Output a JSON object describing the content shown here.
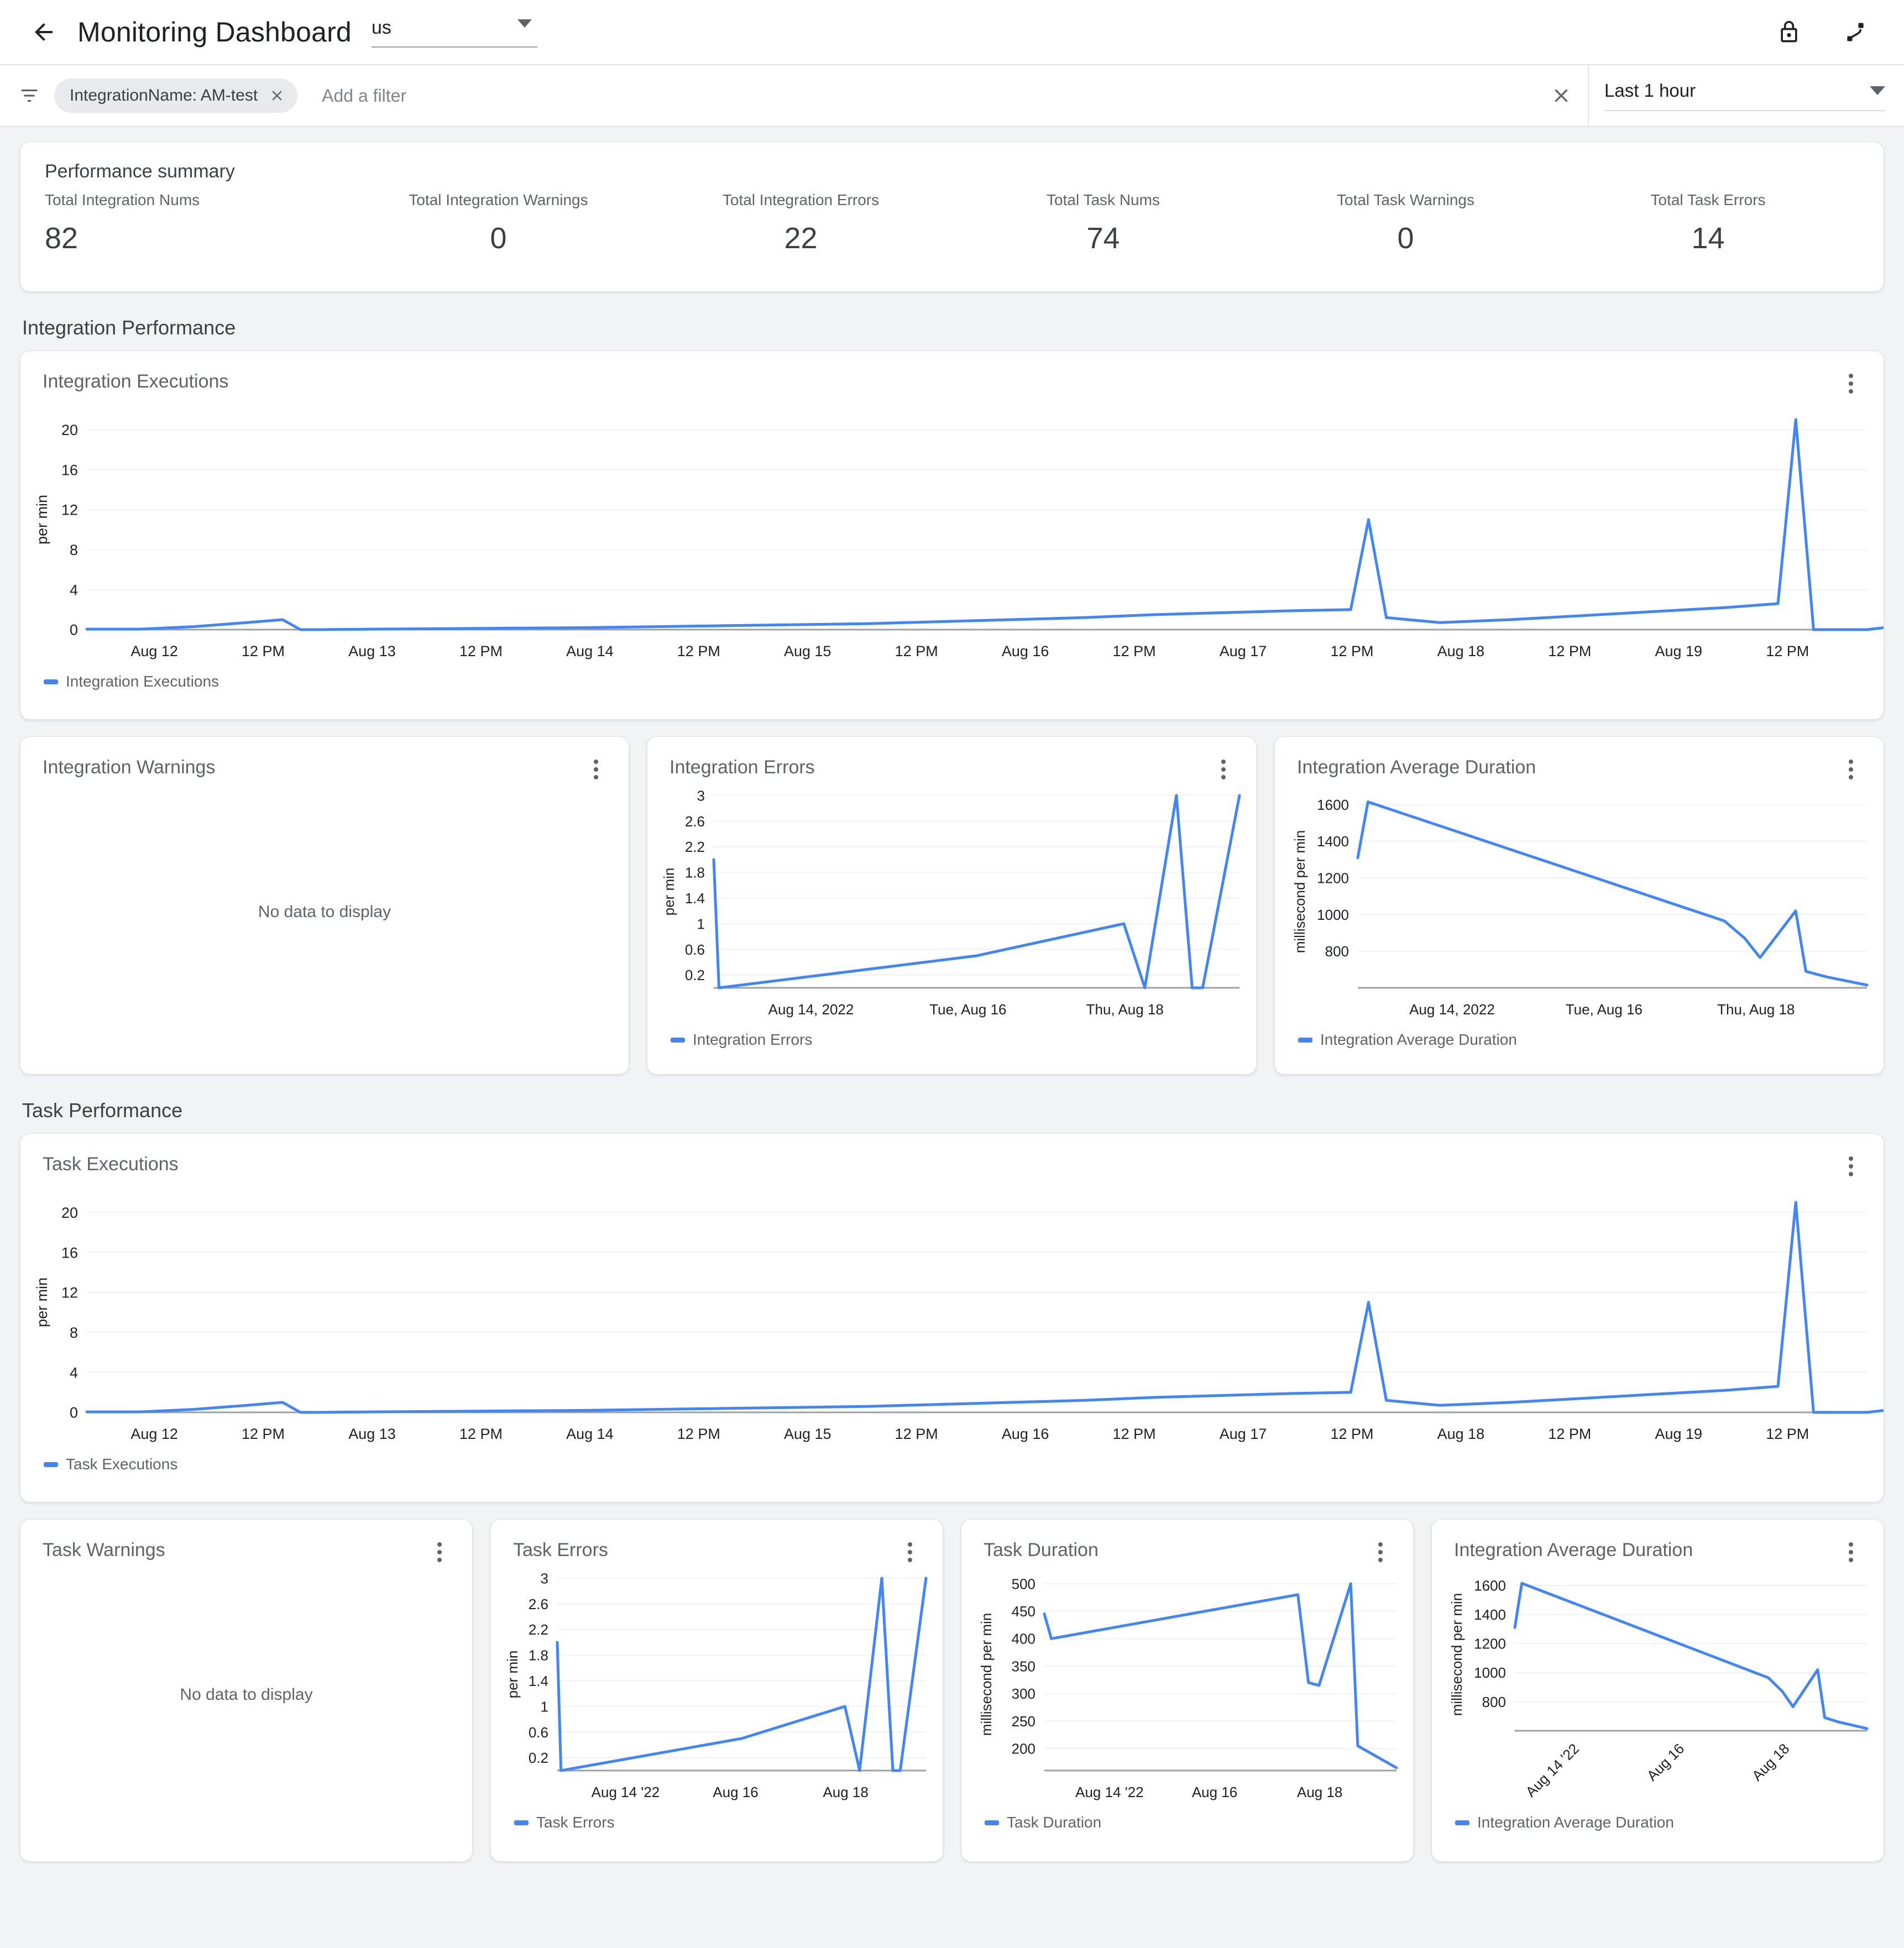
{
  "appbar": {
    "title": "Monitoring Dashboard",
    "back_icon": "back-arrow-icon",
    "region_value": "us",
    "lock_icon": "lock-icon",
    "connection_icon": "connection-cable-icon"
  },
  "filterbar": {
    "filter_icon": "filter-list-icon",
    "chip_label": "IntegrationName: AM-test",
    "chip_remove_icon": "close-icon",
    "add_filter_placeholder": "Add a filter",
    "clear_icon": "close-icon",
    "time_range_value": "Last 1 hour"
  },
  "summary": {
    "title": "Performance summary",
    "metrics": [
      {
        "label": "Total Integration Nums",
        "value": "82"
      },
      {
        "label": "Total Integration Warnings",
        "value": "0"
      },
      {
        "label": "Total Integration Errors",
        "value": "22"
      },
      {
        "label": "Total Task Nums",
        "value": "74"
      },
      {
        "label": "Total Task Warnings",
        "value": "0"
      },
      {
        "label": "Total Task Errors",
        "value": "14"
      }
    ]
  },
  "sections": {
    "integration_performance": "Integration Performance",
    "task_performance": "Task Performance"
  },
  "cards": {
    "integration_executions": {
      "title": "Integration Executions",
      "legend": "Integration Executions"
    },
    "integration_warnings": {
      "title": "Integration Warnings",
      "empty": "No data to display"
    },
    "integration_errors": {
      "title": "Integration Errors",
      "legend": "Integration Errors"
    },
    "integration_avg_duration": {
      "title": "Integration Average Duration",
      "legend": "Integration Average Duration"
    },
    "task_executions": {
      "title": "Task Executions",
      "legend": "Task Executions"
    },
    "task_warnings": {
      "title": "Task Warnings",
      "empty": "No data to display"
    },
    "task_errors": {
      "title": "Task Errors",
      "legend": "Task Errors"
    },
    "task_duration": {
      "title": "Task Duration",
      "legend": "Task Duration"
    },
    "task_integration_avg_duration": {
      "title": "Integration Average Duration",
      "legend": "Integration Average Duration"
    }
  },
  "colors": {
    "series_blue": "#4285f4",
    "axis_gray": "#80868b",
    "grid_gray": "#f1f1f1",
    "page_bg": "#f1f3f4"
  },
  "chart_data": [
    {
      "id": "integration_executions",
      "type": "line",
      "title": "Integration Executions",
      "ylabel": "per min",
      "xlabel": "",
      "ylim": [
        0,
        22
      ],
      "yticks": [
        0,
        4,
        8,
        12,
        16,
        20
      ],
      "grid": true,
      "legend": [
        "Integration Executions"
      ],
      "legend_position": "bottom-left",
      "xticks": [
        "Aug 12",
        "12 PM",
        "Aug 13",
        "12 PM",
        "Aug 14",
        "12 PM",
        "Aug 15",
        "12 PM",
        "Aug 16",
        "12 PM",
        "Aug 17",
        "12 PM",
        "Aug 18",
        "12 PM",
        "Aug 19",
        "12 PM"
      ],
      "series": [
        {
          "name": "Integration Executions",
          "x": [
            0,
            3,
            6,
            9,
            11,
            12,
            13,
            16,
            20,
            24,
            28,
            32,
            36,
            40,
            44,
            48,
            52,
            56,
            60,
            64,
            68,
            71,
            72,
            73,
            76,
            80,
            84,
            88,
            92,
            95,
            96,
            97,
            100,
            104,
            108,
            112
          ],
          "values": [
            0.05,
            0.05,
            0.3,
            0.7,
            1.0,
            0.0,
            0.0,
            0.05,
            0.1,
            0.15,
            0.2,
            0.3,
            0.4,
            0.5,
            0.6,
            0.8,
            1.0,
            1.2,
            1.5,
            1.7,
            1.9,
            2.0,
            11.0,
            1.2,
            0.7,
            1.0,
            1.4,
            1.8,
            2.2,
            2.6,
            21.0,
            0.0,
            0.0,
            0.8,
            1.8,
            2.7
          ]
        }
      ]
    },
    {
      "id": "integration_warnings",
      "type": "line",
      "title": "Integration Warnings",
      "empty": true,
      "empty_text": "No data to display",
      "series": []
    },
    {
      "id": "integration_errors",
      "type": "line",
      "title": "Integration Errors",
      "ylabel": "per min",
      "xlabel": "",
      "ylim": [
        0,
        3
      ],
      "yticks": [
        0.2,
        0.6,
        1,
        1.4,
        1.8,
        2.2,
        2.6,
        3
      ],
      "grid": true,
      "legend": [
        "Integration Errors"
      ],
      "legend_position": "bottom-left",
      "xticks": [
        "Aug 14, 2022",
        "Tue, Aug 16",
        "Thu, Aug 18"
      ],
      "series": [
        {
          "name": "Integration Errors",
          "x": [
            0,
            1,
            50,
            78,
            82,
            88,
            91,
            93,
            100
          ],
          "values": [
            2.0,
            0.0,
            0.5,
            1.0,
            0.0,
            3.0,
            0.0,
            0.0,
            3.0
          ]
        }
      ]
    },
    {
      "id": "integration_avg_duration",
      "type": "line",
      "title": "Integration Average Duration",
      "ylabel": "millisecond per min",
      "xlabel": "",
      "ylim": [
        600,
        1650
      ],
      "yticks": [
        800,
        1000,
        1200,
        1400,
        1600
      ],
      "grid": true,
      "legend": [
        "Integration Average Duration"
      ],
      "legend_position": "bottom-left",
      "xticks": [
        "Aug 14, 2022",
        "Tue, Aug 16",
        "Thu, Aug 18"
      ],
      "series": [
        {
          "name": "Integration Average Duration",
          "x": [
            0,
            2,
            72,
            76,
            79,
            86,
            88,
            92,
            100
          ],
          "values": [
            1310,
            1615,
            965,
            870,
            765,
            1020,
            690,
            660,
            615
          ]
        }
      ]
    },
    {
      "id": "task_executions",
      "type": "line",
      "title": "Task Executions",
      "ylabel": "per min",
      "xlabel": "",
      "ylim": [
        0,
        22
      ],
      "yticks": [
        0,
        4,
        8,
        12,
        16,
        20
      ],
      "grid": true,
      "legend": [
        "Task Executions"
      ],
      "legend_position": "bottom-left",
      "xticks": [
        "Aug 12",
        "12 PM",
        "Aug 13",
        "12 PM",
        "Aug 14",
        "12 PM",
        "Aug 15",
        "12 PM",
        "Aug 16",
        "12 PM",
        "Aug 17",
        "12 PM",
        "Aug 18",
        "12 PM",
        "Aug 19",
        "12 PM"
      ],
      "series": [
        {
          "name": "Task Executions",
          "x": [
            0,
            3,
            6,
            9,
            11,
            12,
            13,
            16,
            20,
            24,
            28,
            32,
            36,
            40,
            44,
            48,
            52,
            56,
            60,
            64,
            68,
            71,
            72,
            73,
            76,
            80,
            84,
            88,
            92,
            95,
            96,
            97,
            100,
            104,
            108,
            112
          ],
          "values": [
            0.05,
            0.05,
            0.3,
            0.7,
            1.0,
            0.0,
            0.0,
            0.05,
            0.1,
            0.15,
            0.2,
            0.3,
            0.4,
            0.5,
            0.6,
            0.8,
            1.0,
            1.2,
            1.5,
            1.7,
            1.9,
            2.0,
            11.0,
            1.2,
            0.7,
            1.0,
            1.4,
            1.8,
            2.2,
            2.6,
            21.0,
            0.0,
            0.0,
            0.8,
            1.8,
            2.7
          ]
        }
      ]
    },
    {
      "id": "task_warnings",
      "type": "line",
      "title": "Task Warnings",
      "empty": true,
      "empty_text": "No data to display",
      "series": []
    },
    {
      "id": "task_errors",
      "type": "line",
      "title": "Task Errors",
      "ylabel": "per min",
      "xlabel": "",
      "ylim": [
        0,
        3
      ],
      "yticks": [
        0.2,
        0.6,
        1,
        1.4,
        1.8,
        2.2,
        2.6,
        3
      ],
      "grid": true,
      "legend": [
        "Task Errors"
      ],
      "legend_position": "bottom-left",
      "xticks": [
        "Aug 14 '22",
        "Aug 16",
        "Aug 18"
      ],
      "series": [
        {
          "name": "Task Errors",
          "x": [
            0,
            1,
            50,
            78,
            82,
            88,
            91,
            93,
            100
          ],
          "values": [
            2.0,
            0.0,
            0.5,
            1.0,
            0.0,
            3.0,
            0.0,
            0.0,
            3.0
          ]
        }
      ]
    },
    {
      "id": "task_duration",
      "type": "line",
      "title": "Task Duration",
      "ylabel": "millisecond per min",
      "xlabel": "",
      "ylim": [
        160,
        510
      ],
      "yticks": [
        200,
        250,
        300,
        350,
        400,
        450,
        500
      ],
      "grid": true,
      "legend": [
        "Task Duration"
      ],
      "legend_position": "bottom-left",
      "xticks": [
        "Aug 14 '22",
        "Aug 16",
        "Aug 18"
      ],
      "series": [
        {
          "name": "Task Duration",
          "x": [
            0,
            2,
            72,
            75,
            78,
            87,
            89,
            100
          ],
          "values": [
            445,
            400,
            480,
            320,
            315,
            500,
            205,
            165
          ]
        }
      ]
    },
    {
      "id": "task_integration_avg_duration",
      "type": "line",
      "title": "Integration Average Duration",
      "ylabel": "millisecond per min",
      "xlabel": "",
      "ylim": [
        600,
        1650
      ],
      "yticks": [
        800,
        1000,
        1200,
        1400,
        1600
      ],
      "grid": true,
      "legend": [
        "Integration Average Duration"
      ],
      "legend_position": "bottom-left",
      "xticks": [
        "Aug 14 '22",
        "Aug 16",
        "Aug 18"
      ],
      "xtick_rotation": -45,
      "series": [
        {
          "name": "Integration Average Duration",
          "x": [
            0,
            2,
            72,
            76,
            79,
            86,
            88,
            92,
            100
          ],
          "values": [
            1310,
            1615,
            965,
            870,
            765,
            1020,
            690,
            660,
            615
          ]
        }
      ]
    }
  ]
}
